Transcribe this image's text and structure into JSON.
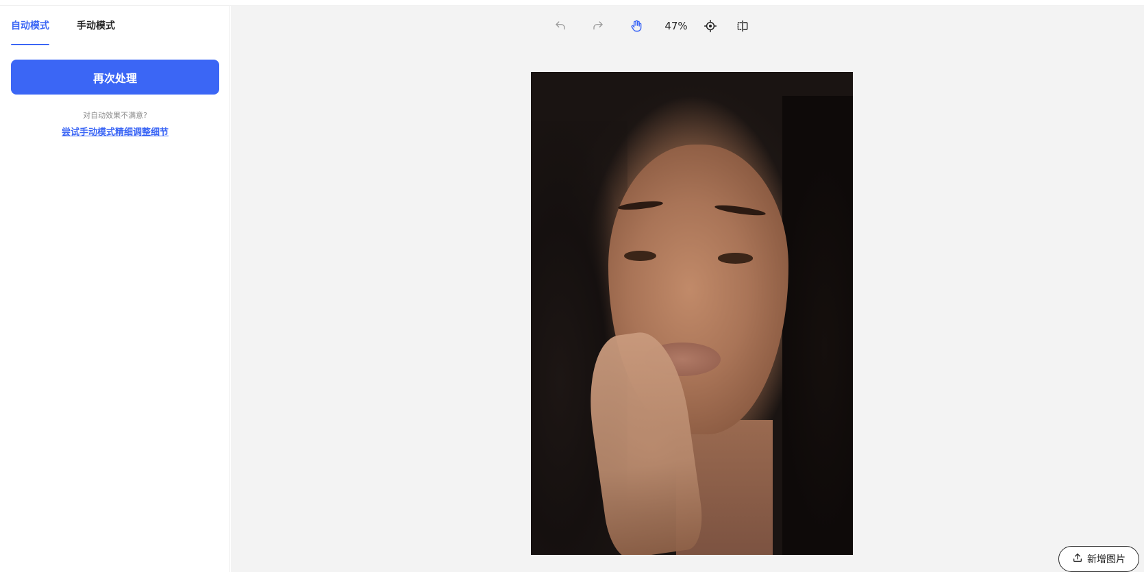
{
  "sidebar": {
    "tabs": [
      {
        "label": "自动模式",
        "active": true
      },
      {
        "label": "手动模式",
        "active": false
      }
    ],
    "reprocess_label": "再次处理",
    "hint_text": "对自动效果不满意?",
    "hint_link": "尝试手动模式精细调整细节"
  },
  "toolbar": {
    "undo_icon": "undo-icon",
    "redo_icon": "redo-icon",
    "hand_icon": "hand-pan-icon",
    "zoom_level": "47%",
    "fit_icon": "crosshair-fit-icon",
    "compare_icon": "compare-split-icon"
  },
  "canvas": {
    "image": "portrait-photo"
  },
  "add_image_label": "新增图片",
  "colors": {
    "accent": "#3b66f5",
    "canvas_bg": "#f3f3f3"
  }
}
